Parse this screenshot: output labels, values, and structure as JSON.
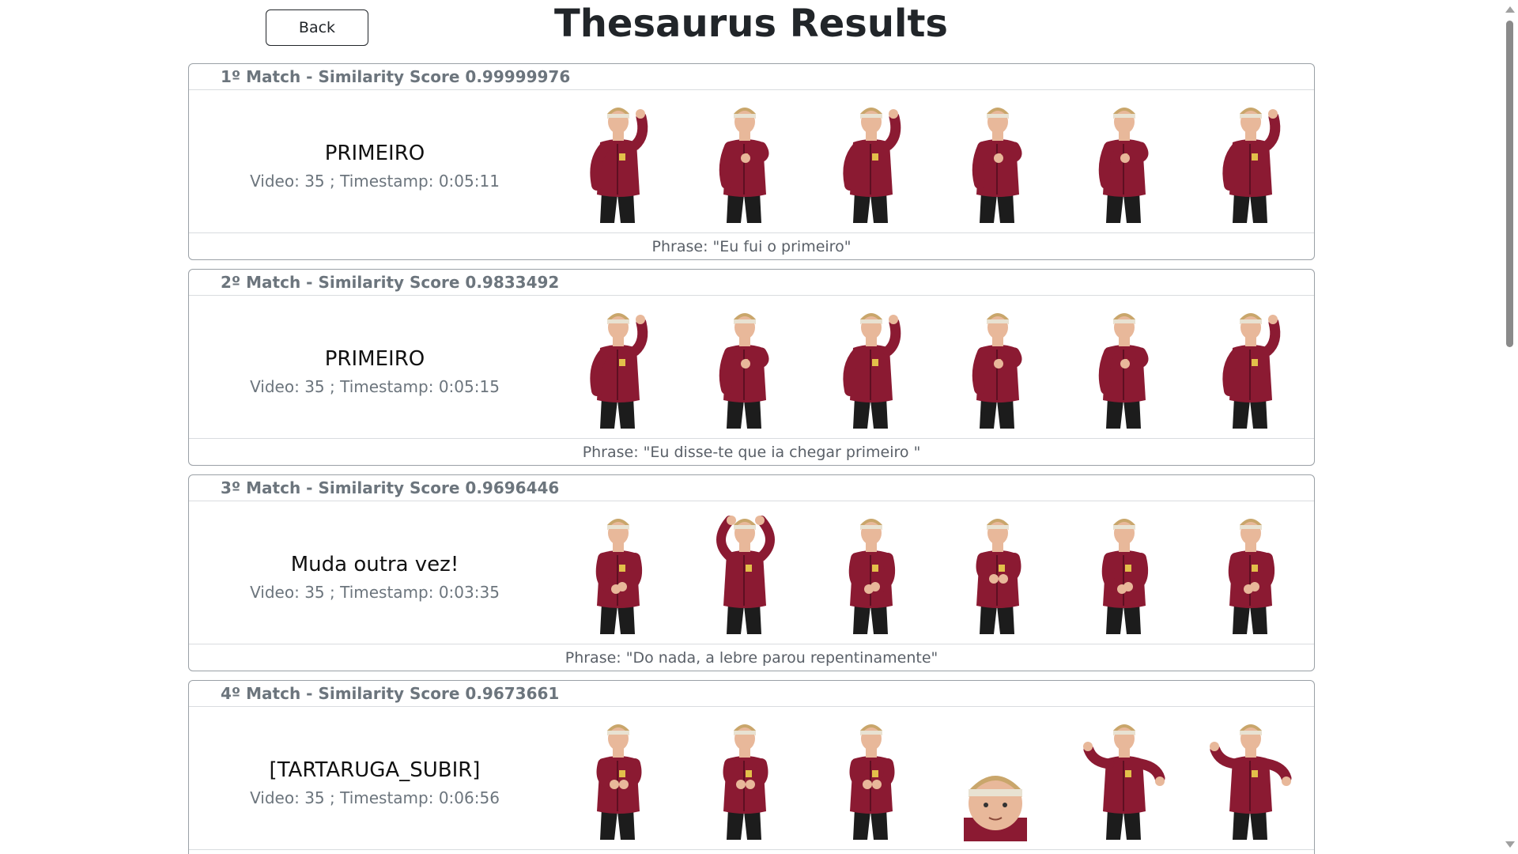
{
  "header": {
    "back_label": "Back",
    "title": "Thesaurus Results"
  },
  "colors": {
    "jacket": "#8b1a32",
    "jacket_shadow": "#5e0f22",
    "skin": "#e8b89a",
    "hair": "#c9a66b",
    "pants": "#1c1c1c"
  },
  "matches": [
    {
      "header": "1º Match - Similarity Score 0.99999976",
      "gloss": "PRIMEIRO",
      "meta": "Video: 35 ; Timestamp: 0:05:11",
      "phrase": "Phrase: \"Eu fui o primeiro\"",
      "poses": [
        "hand-up",
        "hand-chest",
        "hand-up",
        "hand-chest",
        "hand-chest",
        "hand-up"
      ]
    },
    {
      "header": "2º Match - Similarity Score 0.9833492",
      "gloss": "PRIMEIRO",
      "meta": "Video: 35 ; Timestamp: 0:05:15",
      "phrase": "Phrase: \"Eu disse-te que ia chegar primeiro \"",
      "poses": [
        "hand-up",
        "hand-chest",
        "hand-up",
        "hand-chest",
        "hand-chest",
        "hand-up"
      ]
    },
    {
      "header": "3º Match - Similarity Score 0.9696446",
      "gloss": "Muda outra vez!",
      "meta": "Video: 35 ; Timestamp: 0:03:35",
      "phrase": "Phrase: \"Do nada, a lebre parou repentinamente\"",
      "poses": [
        "hands-low",
        "arms-head",
        "hands-low",
        "hands-mid",
        "hands-low",
        "hands-low"
      ]
    },
    {
      "header": "4º Match - Similarity Score 0.9673661",
      "gloss": "[TARTARUGA_SUBIR]",
      "meta": "Video: 35 ; Timestamp: 0:06:56",
      "phrase": "",
      "poses": [
        "hands-mid",
        "hands-mid",
        "hands-mid",
        "close-face",
        "arms-out",
        "arms-out"
      ]
    }
  ]
}
